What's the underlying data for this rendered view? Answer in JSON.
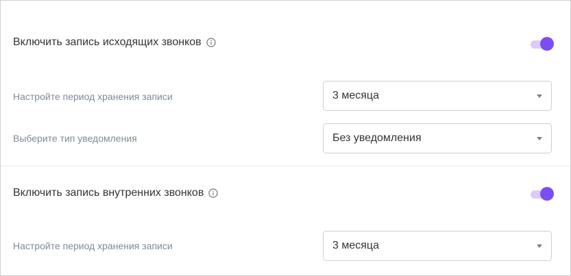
{
  "sections": [
    {
      "title": "Включить запись исходящих звонков",
      "toggle_on": true,
      "fields": [
        {
          "label": "Настройте период хранения записи",
          "value": "3 месяца"
        },
        {
          "label": "Выберите тип уведомления",
          "value": "Без уведомления"
        }
      ]
    },
    {
      "title": "Включить запись внутренних звонков",
      "toggle_on": true,
      "fields": [
        {
          "label": "Настройте период хранения записи",
          "value": "3 месяца"
        }
      ]
    }
  ],
  "colors": {
    "accent": "#7b4df2",
    "toggle_track": "#d9ccfb",
    "label": "#7d8a97",
    "border": "#c9ced4"
  },
  "icons": [
    "info-icon",
    "chevron-down-icon"
  ]
}
